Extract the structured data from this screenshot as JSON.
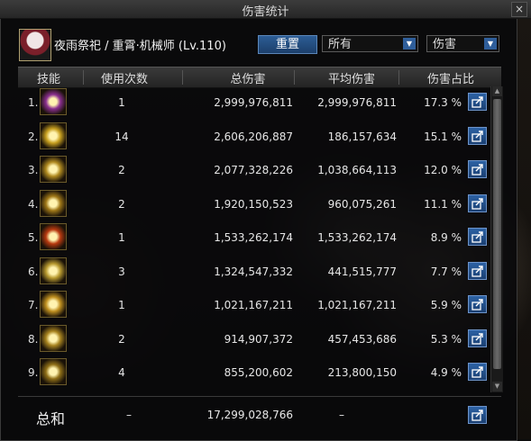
{
  "window": {
    "title": "伤害统计",
    "close": "×"
  },
  "header": {
    "character": "夜雨祭祀 / 重霄·机械师 (Lv.110)",
    "reset_label": "重置",
    "filter_value": "所有",
    "type_value": "伤害"
  },
  "columns": [
    "技能",
    "使用次数",
    "总伤害",
    "平均伤害",
    "伤害占比"
  ],
  "rows": [
    {
      "rank": "1.",
      "uses": "1",
      "total": "2,999,976,811",
      "avg": "2,999,976,811",
      "pct": "17.3 %",
      "icon": "skill-icon",
      "color": "#8a2f8f"
    },
    {
      "rank": "2.",
      "uses": "14",
      "total": "2,606,206,887",
      "avg": "186,157,634",
      "pct": "15.1 %",
      "icon": "skill-icon",
      "color": "#c8a020"
    },
    {
      "rank": "3.",
      "uses": "2",
      "total": "2,077,328,226",
      "avg": "1,038,664,113",
      "pct": "12.0 %",
      "icon": "skill-icon",
      "color": "#b08a20"
    },
    {
      "rank": "4.",
      "uses": "2",
      "total": "1,920,150,523",
      "avg": "960,075,261",
      "pct": "11.1 %",
      "icon": "skill-icon",
      "color": "#a07818"
    },
    {
      "rank": "5.",
      "uses": "1",
      "total": "1,533,262,174",
      "avg": "1,533,262,174",
      "pct": "8.9 %",
      "icon": "skill-icon",
      "color": "#b83a10"
    },
    {
      "rank": "6.",
      "uses": "3",
      "total": "1,324,547,332",
      "avg": "441,515,777",
      "pct": "7.7 %",
      "icon": "skill-icon",
      "color": "#b89a30"
    },
    {
      "rank": "7.",
      "uses": "1",
      "total": "1,021,167,211",
      "avg": "1,021,167,211",
      "pct": "5.9 %",
      "icon": "skill-icon",
      "color": "#c09020"
    },
    {
      "rank": "8.",
      "uses": "2",
      "total": "914,907,372",
      "avg": "457,453,686",
      "pct": "5.3 %",
      "icon": "skill-icon",
      "color": "#a88420"
    },
    {
      "rank": "9.",
      "uses": "4",
      "total": "855,200,602",
      "avg": "213,800,150",
      "pct": "4.9 %",
      "icon": "skill-icon",
      "color": "#907018"
    }
  ],
  "total": {
    "label": "总和",
    "uses": "–",
    "damage": "17,299,028,766",
    "avg": "–"
  }
}
